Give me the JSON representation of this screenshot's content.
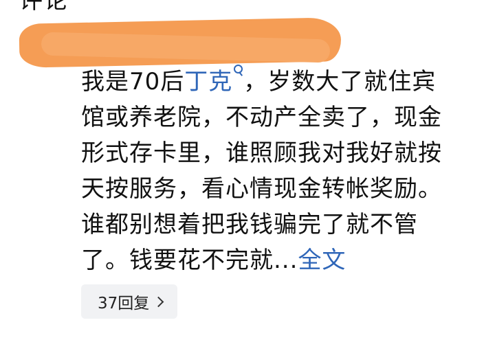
{
  "top_partial_text": "评论",
  "comment": {
    "lines": [
      {
        "before": "我是70后",
        "link": "丁克",
        "after": "，岁数大了就住宾"
      },
      {
        "text": "馆或养老院，不动产全卖了，现金"
      },
      {
        "text": "形式存卡里，谁照顾我对我好就按"
      },
      {
        "text": "天按服务，看心情现金转帐奖励。"
      },
      {
        "text": "谁都别想着把我钱骗完了就不管"
      },
      {
        "before": "了。钱要花不完就...",
        "more": "全文"
      }
    ]
  },
  "reply": {
    "label": "37回复"
  },
  "colors": {
    "link": "#2f66b8",
    "redaction": "#f59d55"
  },
  "icons": {
    "search_term": "search-icon",
    "reply_arrow": "chevron-right-icon"
  }
}
